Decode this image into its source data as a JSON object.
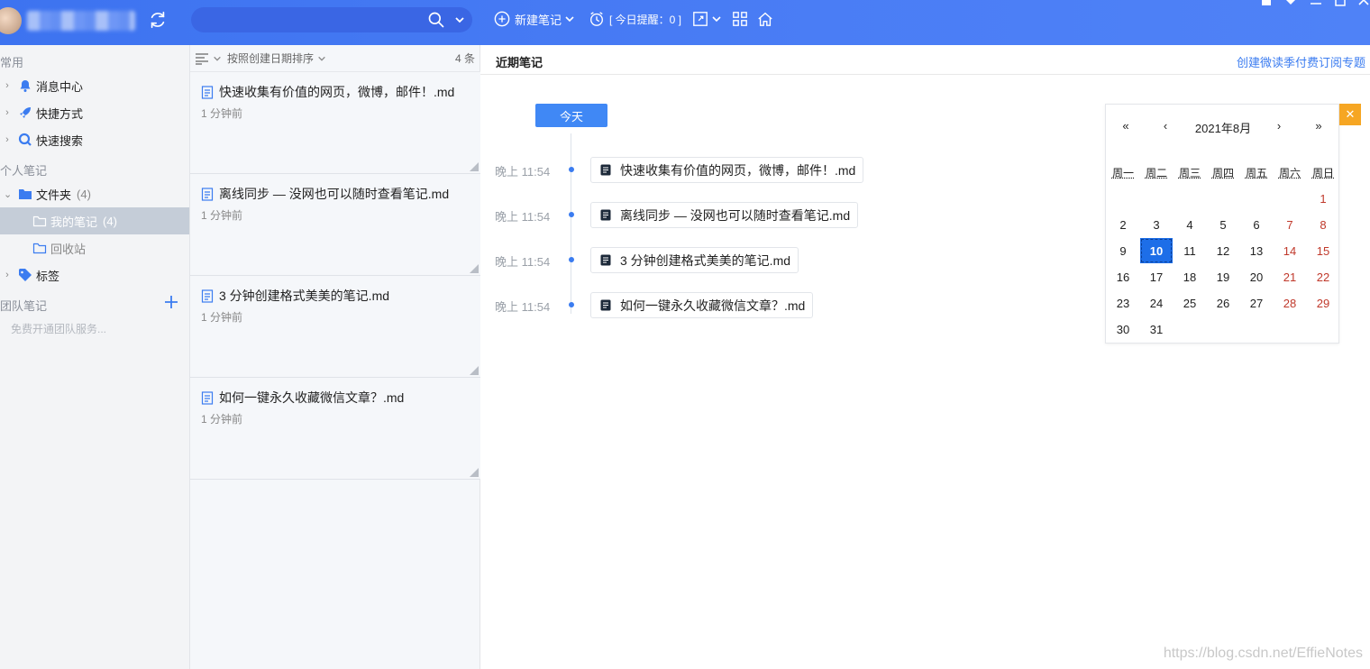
{
  "toolbar": {
    "new_note_label": "新建笔记",
    "reminder_label": "[ 今日提醒：0 ]",
    "search_placeholder": ""
  },
  "sidebar": {
    "common_title": "常用",
    "items": [
      {
        "label": "消息中心",
        "icon": "bell-icon"
      },
      {
        "label": "快捷方式",
        "icon": "rocket-icon"
      },
      {
        "label": "快速搜索",
        "icon": "search-icon"
      }
    ],
    "personal_title": "个人笔记",
    "folder": {
      "label": "文件夹",
      "count": "(4)"
    },
    "my_notes": {
      "label": "我的笔记",
      "count": "(4)"
    },
    "recycle": {
      "label": "回收站"
    },
    "tags": {
      "label": "标签"
    },
    "team_title": "团队笔记",
    "team_hint": "免费开通团队服务..."
  },
  "notelist": {
    "sort_label": "按照创建日期排序",
    "count_label": "4 条",
    "notes": [
      {
        "title": "快速收集有价值的网页，微博，邮件！.md",
        "time": "1 分钟前"
      },
      {
        "title": "离线同步 — 没网也可以随时查看笔记.md",
        "time": "1 分钟前"
      },
      {
        "title": "3 分钟创建格式美美的笔记.md",
        "time": "1 分钟前"
      },
      {
        "title": "如何一键永久收藏微信文章？.md",
        "time": "1 分钟前"
      }
    ]
  },
  "main": {
    "title": "近期笔记",
    "link": "创建微读季付费订阅专题",
    "today_button": "今天",
    "timeline": [
      {
        "time": "晚上 11:54",
        "title": "快速收集有价值的网页，微博，邮件！.md"
      },
      {
        "time": "晚上 11:54",
        "title": "离线同步 — 没网也可以随时查看笔记.md"
      },
      {
        "time": "晚上 11:54",
        "title": "3 分钟创建格式美美的笔记.md"
      },
      {
        "time": "晚上 11:54",
        "title": "如何一键永久收藏微信文章？.md"
      }
    ]
  },
  "calendar": {
    "prev_year": "«",
    "prev_month": "‹",
    "month_label": "2021年8月",
    "next_month": "›",
    "next_year": "»",
    "weekdays": [
      "周一",
      "周二",
      "周三",
      "周四",
      "周五",
      "周六",
      "周日"
    ],
    "selected_day": "10",
    "weeks": [
      [
        "",
        "",
        "",
        "",
        "",
        "",
        "1"
      ],
      [
        "2",
        "3",
        "4",
        "5",
        "6",
        "7",
        "8"
      ],
      [
        "9",
        "10",
        "11",
        "12",
        "13",
        "14",
        "15"
      ],
      [
        "16",
        "17",
        "18",
        "19",
        "20",
        "21",
        "22"
      ],
      [
        "23",
        "24",
        "25",
        "26",
        "27",
        "28",
        "29"
      ],
      [
        "30",
        "31",
        "",
        "",
        "",
        "",
        ""
      ]
    ],
    "close_label": "✕"
  },
  "watermark": "https://blog.csdn.net/EffieNotes",
  "colors": {
    "accent": "#3b7cf0",
    "topbar": "#4a7df5",
    "weekend": "#c0392b",
    "close": "#f6a623"
  }
}
